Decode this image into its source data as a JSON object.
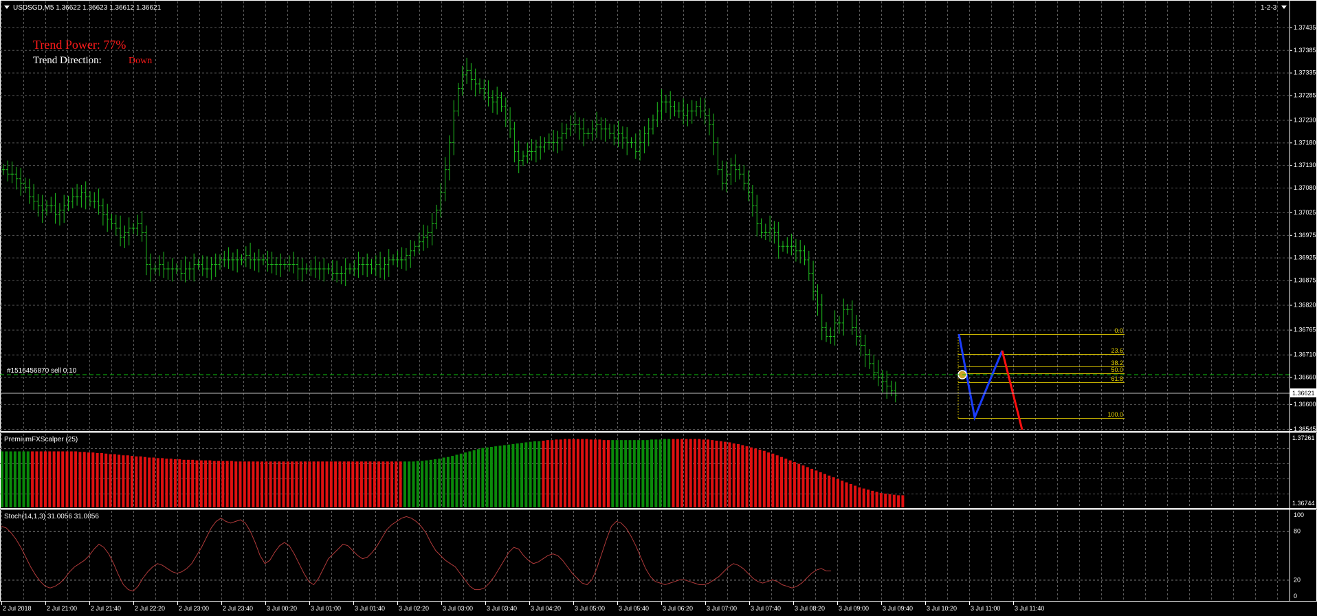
{
  "header": {
    "symbol_line": "USDSGD,M5  1.36622 1.36623 1.36612 1.36621",
    "corner": "1-2-3"
  },
  "overlay": {
    "trend_power_label": "Trend Power: 77%",
    "trend_direction_label": "Trend Direction:",
    "trend_direction_value": "Down",
    "colors": {
      "power": "#ff1a1a",
      "direction_value": "#ff1a1a"
    }
  },
  "order": {
    "label": "#1516456870 sell 0.10",
    "price": 1.3666
  },
  "price_axis": {
    "ticks": [
      "1.37435",
      "1.37385",
      "1.37335",
      "1.37285",
      "1.37230",
      "1.37180",
      "1.37130",
      "1.37080",
      "1.37025",
      "1.36975",
      "1.36925",
      "1.36875",
      "1.36820",
      "1.36765",
      "1.36710",
      "1.36660",
      "1.36600",
      "1.36545"
    ],
    "current": "1.36621"
  },
  "fib": {
    "levels": [
      "0.0",
      "23.6",
      "38.2",
      "50.0",
      "61.8",
      "100.0"
    ]
  },
  "time_axis": {
    "labels": [
      "2 Jul 2018",
      "2 Jul 21:00",
      "2 Jul 21:40",
      "2 Jul 22:20",
      "2 Jul 23:00",
      "2 Jul 23:40",
      "3 Jul 00:20",
      "3 Jul 01:00",
      "3 Jul 01:40",
      "3 Jul 02:20",
      "3 Jul 03:00",
      "3 Jul 03:40",
      "3 Jul 04:20",
      "3 Jul 05:00",
      "3 Jul 05:40",
      "3 Jul 06:20",
      "3 Jul 07:00",
      "3 Jul 07:40",
      "3 Jul 08:20",
      "3 Jul 09:00",
      "3 Jul 09:40",
      "3 Jul 10:20",
      "3 Jul 11:00",
      "3 Jul 11:40"
    ]
  },
  "indicator1": {
    "title": "PremiumFXScalper (25)",
    "axis_top": "1.37261",
    "axis_bottom": "1.36744",
    "colors": {
      "green": "#0a8a0a",
      "red": "#e01010"
    }
  },
  "indicator2": {
    "title": "Stoch(14,1,3) 31.0056 31.0056",
    "axis": [
      "100",
      "80",
      "20",
      "0"
    ],
    "line_color": "#b03a3a"
  },
  "chart_data": {
    "type": "bar",
    "title": "",
    "price_close": [
      1.3712,
      1.3711,
      1.3711,
      1.371,
      1.3709,
      1.3708,
      1.3706,
      1.3705,
      1.3704,
      1.3703,
      1.3704,
      1.3704,
      1.3702,
      1.3703,
      1.3704,
      1.3705,
      1.3706,
      1.3706,
      1.3707,
      1.3706,
      1.3705,
      1.3705,
      1.3704,
      1.3702,
      1.3701,
      1.37,
      1.3699,
      1.3697,
      1.3698,
      1.3699,
      1.3699,
      1.37,
      1.3698,
      1.3691,
      1.369,
      1.369,
      1.3691,
      1.369,
      1.369,
      1.369,
      1.369,
      1.3689,
      1.369,
      1.369,
      1.3691,
      1.3691,
      1.369,
      1.369,
      1.3691,
      1.3691,
      1.3692,
      1.3692,
      1.3692,
      1.3692,
      1.3692,
      1.3692,
      1.3693,
      1.3692,
      1.3692,
      1.3692,
      1.3692,
      1.3691,
      1.3691,
      1.3691,
      1.3691,
      1.3691,
      1.3691,
      1.3691,
      1.369,
      1.369,
      1.369,
      1.369,
      1.369,
      1.369,
      1.369,
      1.369,
      1.3689,
      1.3689,
      1.3689,
      1.369,
      1.369,
      1.369,
      1.3691,
      1.3691,
      1.3691,
      1.369,
      1.3691,
      1.369,
      1.3691,
      1.3692,
      1.3692,
      1.3692,
      1.3692,
      1.3693,
      1.3694,
      1.3695,
      1.3696,
      1.3697,
      1.3698,
      1.37,
      1.3703,
      1.3707,
      1.3712,
      1.3718,
      1.3725,
      1.373,
      1.3733,
      1.3734,
      1.3732,
      1.3731,
      1.373,
      1.3729,
      1.3728,
      1.3727,
      1.3728,
      1.3726,
      1.3723,
      1.3721,
      1.3716,
      1.3714,
      1.3715,
      1.3716,
      1.3716,
      1.3717,
      1.3717,
      1.3718,
      1.3718,
      1.3718,
      1.3719,
      1.372,
      1.3721,
      1.3722,
      1.3722,
      1.3721,
      1.372,
      1.372,
      1.3721,
      1.3722,
      1.3721,
      1.3721,
      1.372,
      1.3719,
      1.372,
      1.3719,
      1.3718,
      1.3718,
      1.3716,
      1.3718,
      1.372,
      1.3721,
      1.3723,
      1.3725,
      1.3727,
      1.3727,
      1.3726,
      1.3725,
      1.3725,
      1.3724,
      1.3725,
      1.3725,
      1.3726,
      1.3725,
      1.3724,
      1.3722,
      1.3718,
      1.3712,
      1.3709,
      1.3711,
      1.3713,
      1.3712,
      1.3711,
      1.3709,
      1.3707,
      1.3704,
      1.37,
      1.3698,
      1.3698,
      1.3699,
      1.3698,
      1.3695,
      1.3695,
      1.3695,
      1.3695,
      1.3694,
      1.3694,
      1.3692,
      1.3689,
      1.3685,
      1.3682,
      1.3677,
      1.3675,
      1.3675,
      1.3678,
      1.3678,
      1.3681,
      1.3681,
      1.3677,
      1.3675,
      1.3673,
      1.3671,
      1.3669,
      1.3667,
      1.3666,
      1.3665,
      1.3664,
      1.3663,
      1.3662
    ],
    "scalper_state": [
      "g",
      "g",
      "g",
      "g",
      "g",
      "g",
      "g",
      "r",
      "r",
      "r",
      "r",
      "r",
      "r",
      "r",
      "r",
      "r",
      "r",
      "r",
      "r",
      "r",
      "r",
      "r",
      "r",
      "r",
      "r",
      "r",
      "r",
      "r",
      "r",
      "r",
      "r",
      "r",
      "r",
      "r",
      "r",
      "r",
      "r",
      "r",
      "r",
      "r",
      "r",
      "r",
      "r",
      "r",
      "r",
      "r",
      "r",
      "r",
      "r",
      "r",
      "r",
      "r",
      "r",
      "r",
      "r",
      "r",
      "r",
      "r",
      "r",
      "r",
      "r",
      "r",
      "r",
      "r",
      "r",
      "r",
      "r",
      "r",
      "r",
      "r",
      "r",
      "r",
      "r",
      "r",
      "r",
      "r",
      "r",
      "r",
      "r",
      "r",
      "r",
      "r",
      "r",
      "r",
      "r",
      "r",
      "r",
      "r",
      "r",
      "r",
      "r",
      "r",
      "r",
      "g",
      "g",
      "g",
      "g",
      "g",
      "g",
      "g",
      "g",
      "g",
      "g",
      "g",
      "g",
      "g",
      "g",
      "g",
      "g",
      "g",
      "g",
      "g",
      "g",
      "g",
      "g",
      "g",
      "g",
      "g",
      "g",
      "g",
      "g",
      "g",
      "g",
      "g",
      "g",
      "r",
      "r",
      "r",
      "r",
      "r",
      "r",
      "r",
      "r",
      "r",
      "r",
      "r",
      "r",
      "r",
      "r",
      "r",
      "r",
      "g",
      "g",
      "g",
      "g",
      "g",
      "g",
      "g",
      "g",
      "g",
      "g",
      "g",
      "g",
      "g",
      "g",
      "r",
      "r",
      "r",
      "r",
      "r",
      "r",
      "r",
      "r",
      "r",
      "r",
      "r",
      "r",
      "r",
      "r",
      "r",
      "r",
      "r",
      "r",
      "r",
      "r",
      "r",
      "r",
      "r",
      "r",
      "r",
      "r",
      "r",
      "r",
      "r",
      "r",
      "r",
      "r",
      "r",
      "r",
      "r",
      "r",
      "r",
      "r",
      "r",
      "r",
      "r",
      "r",
      "r",
      "r",
      "r",
      "r",
      "r",
      "r",
      "r",
      "r",
      "r",
      "r",
      "r",
      "r",
      "r",
      "r",
      "r",
      "r",
      "r",
      "r",
      "r",
      "r",
      "r",
      "r"
    ],
    "scalper_level": [
      0.78,
      0.78,
      0.78,
      0.78,
      0.78,
      0.78,
      0.78,
      0.78,
      0.78,
      0.78,
      0.78,
      0.78,
      0.78,
      0.78,
      0.78,
      0.78,
      0.78,
      0.78,
      0.77,
      0.77,
      0.76,
      0.76,
      0.75,
      0.75,
      0.74,
      0.73,
      0.73,
      0.72,
      0.71,
      0.71,
      0.7,
      0.69,
      0.69,
      0.68,
      0.67,
      0.67,
      0.66,
      0.66,
      0.65,
      0.65,
      0.64,
      0.64,
      0.63,
      0.63,
      0.63,
      0.62,
      0.62,
      0.62,
      0.62,
      0.61,
      0.61,
      0.61,
      0.61,
      0.61,
      0.6,
      0.6,
      0.6,
      0.6,
      0.6,
      0.6,
      0.6,
      0.6,
      0.6,
      0.6,
      0.6,
      0.6,
      0.6,
      0.6,
      0.6,
      0.6,
      0.6,
      0.6,
      0.6,
      0.6,
      0.6,
      0.6,
      0.6,
      0.6,
      0.6,
      0.6,
      0.6,
      0.6,
      0.6,
      0.6,
      0.6,
      0.6,
      0.6,
      0.6,
      0.6,
      0.6,
      0.6,
      0.6,
      0.6,
      0.6,
      0.6,
      0.6,
      0.61,
      0.61,
      0.62,
      0.63,
      0.64,
      0.65,
      0.67,
      0.68,
      0.7,
      0.72,
      0.74,
      0.76,
      0.78,
      0.8,
      0.82,
      0.84,
      0.85,
      0.86,
      0.87,
      0.88,
      0.89,
      0.9,
      0.91,
      0.92,
      0.93,
      0.94,
      0.95,
      0.96,
      0.96,
      0.97,
      0.98,
      0.98,
      0.99,
      0.99,
      1.0,
      1.0,
      1.0,
      1.0,
      1.0,
      1.0,
      0.99,
      0.99,
      0.99,
      0.98,
      0.98,
      0.98,
      0.98,
      0.98,
      0.98,
      0.98,
      0.98,
      0.98,
      0.98,
      0.98,
      0.99,
      0.99,
      0.99,
      1.0,
      1.0,
      1.0,
      1.0,
      1.0,
      1.0,
      1.0,
      1.0,
      1.0,
      0.99,
      0.99,
      0.98,
      0.97,
      0.96,
      0.95,
      0.94,
      0.92,
      0.91,
      0.89,
      0.87,
      0.85,
      0.83,
      0.81,
      0.79,
      0.76,
      0.74,
      0.71,
      0.68,
      0.65,
      0.62,
      0.59,
      0.56,
      0.53,
      0.5,
      0.47,
      0.44,
      0.41,
      0.38,
      0.35,
      0.32,
      0.29,
      0.26,
      0.23,
      0.2,
      0.17,
      0.14,
      0.12,
      0.1,
      0.08,
      0.06,
      0.04,
      0.03,
      0.02,
      0.01,
      0.0,
      0.0
    ],
    "stoch": [
      86,
      84,
      78,
      70,
      60,
      48,
      36,
      26,
      18,
      12,
      10,
      12,
      16,
      22,
      30,
      36,
      40,
      44,
      50,
      58,
      64,
      60,
      52,
      40,
      26,
      14,
      8,
      6,
      12,
      22,
      30,
      36,
      40,
      38,
      34,
      30,
      28,
      30,
      34,
      40,
      50,
      60,
      72,
      84,
      92,
      96,
      92,
      90,
      92,
      94,
      90,
      80,
      66,
      50,
      40,
      44,
      54,
      62,
      66,
      62,
      52,
      40,
      28,
      18,
      14,
      22,
      34,
      46,
      52,
      58,
      64,
      62,
      56,
      50,
      46,
      48,
      54,
      62,
      72,
      82,
      88,
      92,
      96,
      98,
      96,
      92,
      86,
      78,
      66,
      56,
      50,
      44,
      40,
      36,
      28,
      20,
      12,
      8,
      8,
      10,
      16,
      24,
      34,
      44,
      54,
      60,
      58,
      50,
      44,
      40,
      42,
      46,
      50,
      52,
      50,
      44,
      36,
      28,
      22,
      16,
      14,
      20,
      34,
      52,
      70,
      86,
      92,
      90,
      84,
      74,
      62,
      48,
      34,
      24,
      18,
      16,
      14,
      16,
      18,
      20,
      20,
      18,
      16,
      14,
      14,
      16,
      20,
      24,
      30,
      36,
      40,
      38,
      34,
      28,
      22,
      18,
      16,
      18,
      20,
      18,
      14,
      12,
      10,
      12,
      16,
      22,
      28,
      32,
      34,
      31,
      31
    ]
  }
}
